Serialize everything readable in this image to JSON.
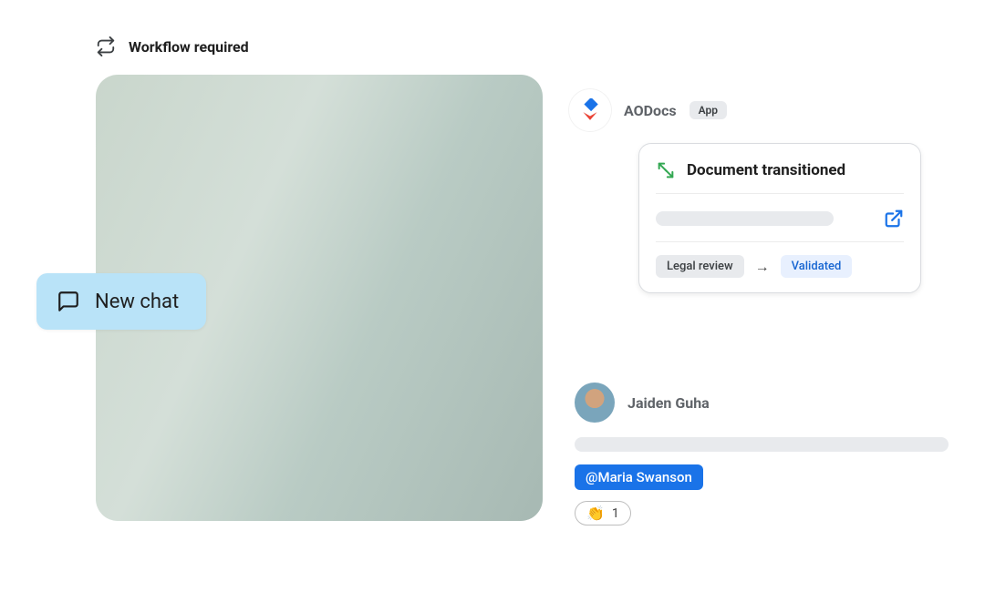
{
  "header": {
    "title": "Workflow required"
  },
  "newChat": {
    "label": "New chat"
  },
  "aodocs": {
    "name": "AODocs",
    "badge": "App"
  },
  "docCard": {
    "title": "Document transitioned",
    "statusFrom": "Legal review",
    "statusTo": "Validated"
  },
  "message": {
    "author": "Jaiden Guha",
    "mention": "@Maria Swanson",
    "reactionEmoji": "👏",
    "reactionCount": "1"
  }
}
